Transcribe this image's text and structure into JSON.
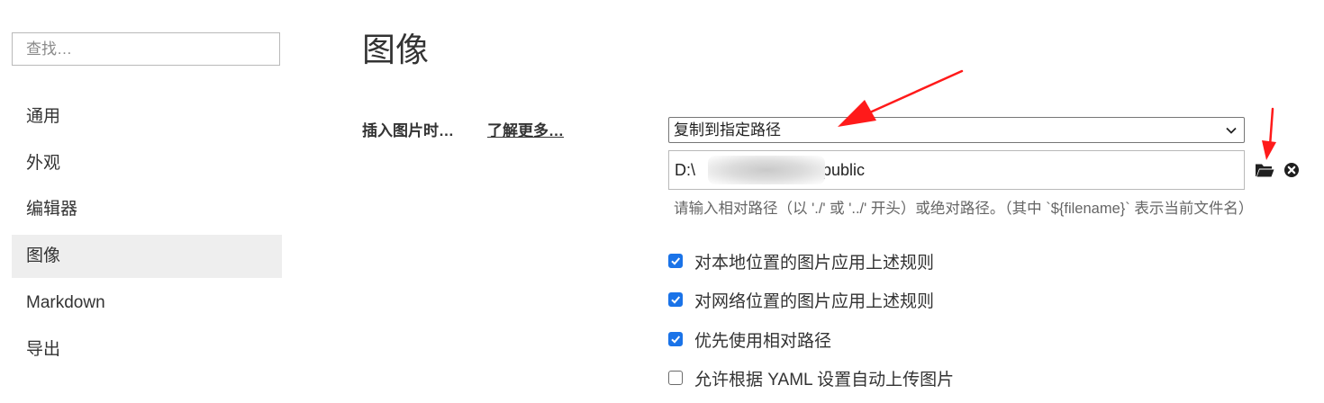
{
  "sidebar": {
    "search_placeholder": "查找…",
    "items": [
      {
        "label": "通用"
      },
      {
        "label": "外观"
      },
      {
        "label": "编辑器"
      },
      {
        "label": "图像",
        "active": true
      },
      {
        "label": "Markdown"
      },
      {
        "label": "导出"
      }
    ]
  },
  "main": {
    "title": "图像",
    "insert_label": "插入图片时…",
    "learn_more": "了解更多…",
    "select_value": "复制到指定路径",
    "path_prefix": "D:\\",
    "path_suffix": "\\public",
    "hint": "请输入相对路径（以 './' 或 '../' 开头）或绝对路径。（其中 `${filename}` 表示当前文件名）",
    "checkboxes": [
      {
        "label": "对本地位置的图片应用上述规则",
        "checked": true
      },
      {
        "label": "对网络位置的图片应用上述规则",
        "checked": true
      },
      {
        "label": "优先使用相对路径",
        "checked": true
      },
      {
        "label": "允许根据 YAML 设置自动上传图片",
        "checked": false
      }
    ]
  },
  "colors": {
    "accent": "#1a73e8",
    "annotation_arrow": "#ff1a1a",
    "active_nav_bg": "#eeeeee"
  },
  "icons": {
    "folder": "folder-open-icon",
    "clear": "close-circle-icon",
    "dropdown": "chevron-down-icon"
  }
}
